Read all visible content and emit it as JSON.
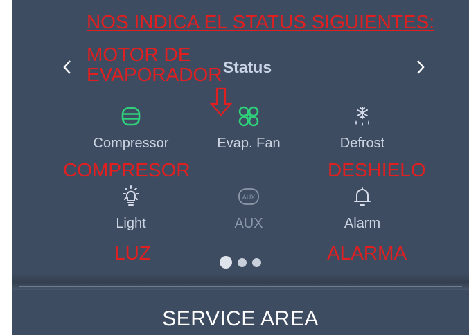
{
  "header": {
    "title": "Status",
    "prev_icon": "chevron-left-icon",
    "next_icon": "chevron-right-icon"
  },
  "status_items": [
    {
      "label": "Compressor",
      "icon": "compressor-icon",
      "state": "active",
      "color": "#2fd07a"
    },
    {
      "label": "Evap. Fan",
      "icon": "fan-icon",
      "state": "active",
      "color": "#2fd07a"
    },
    {
      "label": "Defrost",
      "icon": "snowflake-drip-icon",
      "state": "inactive",
      "color": "#d6dcea"
    },
    {
      "label": "Light",
      "icon": "light-bulb-icon",
      "state": "inactive",
      "color": "#d6dcea"
    },
    {
      "label": "AUX",
      "icon": "aux-icon",
      "state": "disabled",
      "color": "#8c97a8"
    },
    {
      "label": "Alarm",
      "icon": "bell-icon",
      "state": "inactive",
      "color": "#d6dcea"
    }
  ],
  "pagination": {
    "current": 1,
    "total": 3
  },
  "footer": {
    "label": "SERVICE AREA"
  },
  "annotations": {
    "heading": "NOS INDICA EL STATUS SIGUIENTES:",
    "motor_line1": "MOTOR DE",
    "motor_line2": "EVAPORADOR",
    "compresor": "COMPRESOR",
    "deshielo": "DESHIELO",
    "luz": "LUZ",
    "alarma": "ALARMA",
    "color": "#e02020"
  },
  "colors": {
    "background": "#3e4c62",
    "active_icon": "#2fd07a",
    "label": "#cdd5e2",
    "title": "#c9d3e6"
  }
}
